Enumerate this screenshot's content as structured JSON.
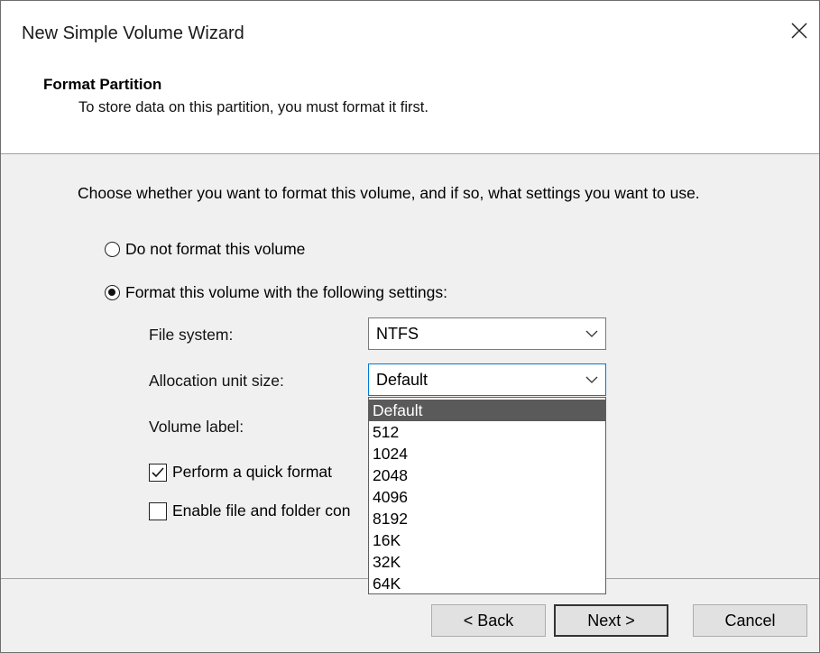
{
  "window": {
    "title": "New Simple Volume Wizard",
    "close_icon": "close-icon"
  },
  "header": {
    "heading": "Format Partition",
    "subheading": "To store data on this partition, you must format it first."
  },
  "main": {
    "instruction": "Choose whether you want to format this volume, and if so, what settings you want to use.",
    "options": [
      {
        "label": "Do not format this volume",
        "checked": false
      },
      {
        "label": "Format this volume with the following settings:",
        "checked": true
      }
    ],
    "fields": {
      "file_system": {
        "label": "File system:",
        "value": "NTFS"
      },
      "allocation_unit_size": {
        "label": "Allocation unit size:",
        "value": "Default"
      },
      "volume_label": {
        "label": "Volume label:"
      }
    },
    "checkboxes": [
      {
        "label": "Perform a quick format",
        "checked": true
      },
      {
        "label": "Enable file and folder con",
        "checked": false
      }
    ],
    "dropdown": {
      "items": [
        "Default",
        "512",
        "1024",
        "2048",
        "4096",
        "8192",
        "16K",
        "32K",
        "64K"
      ],
      "selected": "Default"
    }
  },
  "footer": {
    "back_label": "< Back",
    "next_label": "Next >",
    "cancel_label": "Cancel"
  },
  "colors": {
    "selection": "#5a5a5a",
    "focus_border": "#0078d7"
  }
}
